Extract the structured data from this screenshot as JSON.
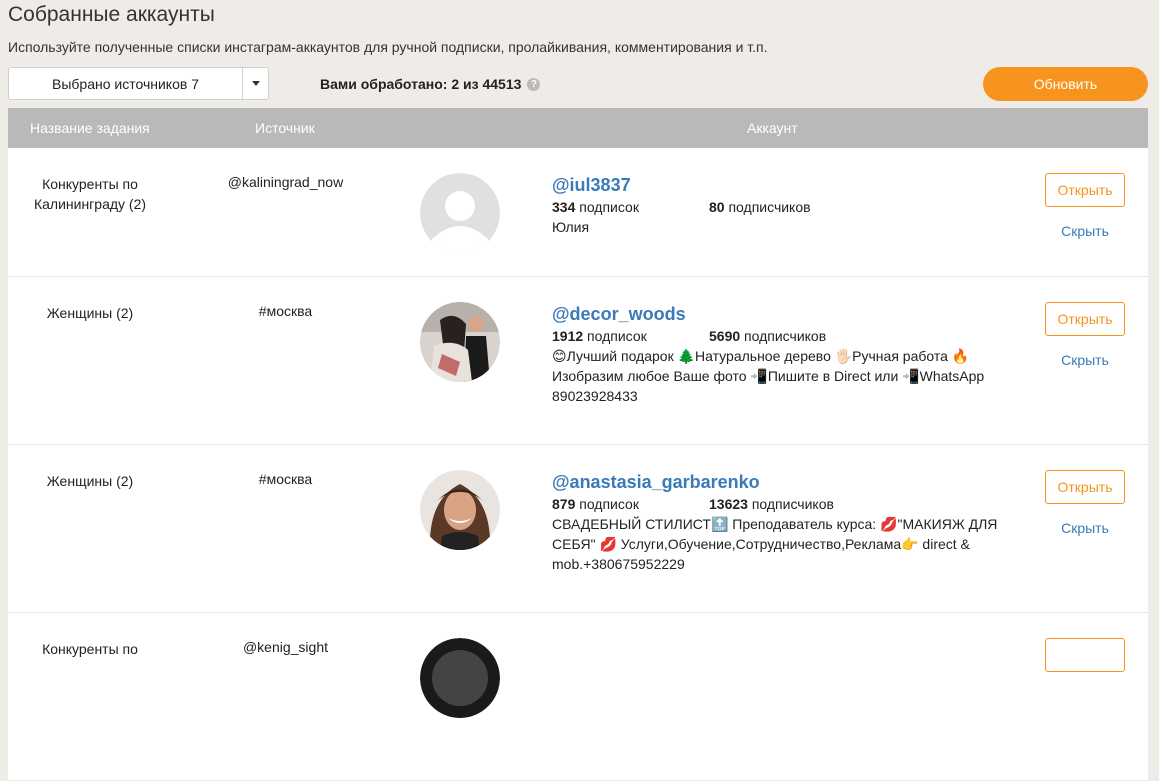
{
  "header": {
    "title": "Собранные аккаунты",
    "subtitle": "Используйте полученные списки инстаграм-аккаунтов для ручной подписки, пролайкивания, комментирования и т.п.",
    "source_select_label": "Выбрано источников 7",
    "processed_text": "Вами обработано: 2 из 44513",
    "refresh_label": "Обновить"
  },
  "table": {
    "columns": {
      "task": "Название задания",
      "source": "Источник",
      "account": "Аккаунт"
    },
    "rows": [
      {
        "task": "Конкуренты по Калининграду (2)",
        "source": "@kaliningrad_now",
        "username": "@iul3837",
        "following_num": "334",
        "following_label": "подписок",
        "followers_num": "80",
        "followers_label": "подписчиков",
        "bio": "Юлия",
        "open_label": "Открыть",
        "hide_label": "Скрыть",
        "avatar": "placeholder"
      },
      {
        "task": "Женщины (2)",
        "source": "#москва",
        "username": "@decor_woods",
        "following_num": "1912",
        "following_label": "подписок",
        "followers_num": "5690",
        "followers_label": "подписчиков",
        "bio": "😊Лучший подарок 🌲Натуральное дерево 🖐🏻Ручная работа 🔥\nИзобразим любое Ваше фото 📲Пишите в Direct или 📲WhatsApp\n89023928433",
        "open_label": "Открыть",
        "hide_label": "Скрыть",
        "avatar": "photo"
      },
      {
        "task": "Женщины (2)",
        "source": "#москва",
        "username": "@anastasia_garbarenko",
        "following_num": "879",
        "following_label": "подписок",
        "followers_num": "13623",
        "followers_label": "подписчиков",
        "bio": "СВАДЕБНЫЙ СТИЛИСТ🔝 Преподаватель курса: 💋\"МАКИЯЖ ДЛЯ\nСЕБЯ\" 💋 Услуги,Обучение,Сотрудничество,Реклама👉 direct &\nmob.+380675952229",
        "open_label": "Открыть",
        "hide_label": "Скрыть",
        "avatar": "photo"
      },
      {
        "task": "Конкуренты по",
        "source": "@kenig_sight",
        "username": "",
        "following_num": "",
        "following_label": "",
        "followers_num": "",
        "followers_label": "",
        "bio": "",
        "open_label": "",
        "hide_label": "",
        "avatar": "photo-dark"
      }
    ]
  },
  "colors": {
    "accent": "#f7941d",
    "link": "#3a7ab8",
    "header_bg": "#b9b9b9",
    "page_bg": "#efece8"
  }
}
